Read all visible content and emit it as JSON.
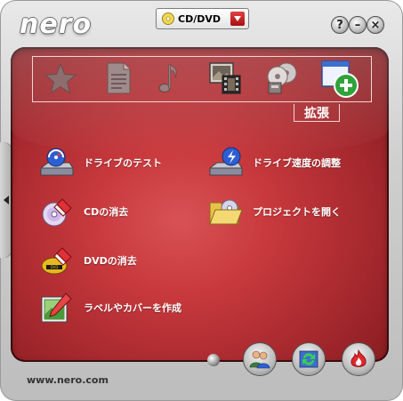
{
  "app": {
    "logo_text": "nero",
    "website": "www.nero.com"
  },
  "mode_selector": {
    "value": "CD/DVD"
  },
  "window_buttons": [
    {
      "name": "help",
      "glyph": "?"
    },
    {
      "name": "minimize",
      "glyph": "–"
    },
    {
      "name": "close",
      "glyph": "×"
    }
  ],
  "categories": {
    "items": [
      {
        "name": "favorites",
        "icon": "star-icon"
      },
      {
        "name": "data",
        "icon": "document-icon"
      },
      {
        "name": "audio",
        "icon": "music-note-icon"
      },
      {
        "name": "photo-video",
        "icon": "film-icon"
      },
      {
        "name": "copy-backup",
        "icon": "disc-copy-icon"
      },
      {
        "name": "extras",
        "icon": "window-add-icon"
      }
    ],
    "selected_label": "拡張"
  },
  "tasks": [
    {
      "label": "ドライブのテスト",
      "icon": "drive-test-icon"
    },
    {
      "label": "ドライブ速度の調整",
      "icon": "drive-speed-icon"
    },
    {
      "label": "CDの消去",
      "icon": "cd-erase-icon"
    },
    {
      "label": "プロジェクトを開く",
      "icon": "open-folder-icon"
    },
    {
      "label": "DVDの消去",
      "icon": "dvd-erase-icon"
    },
    {
      "label": "ラベルやカバーを作成",
      "icon": "label-cover-icon"
    }
  ],
  "bottom_buttons": [
    {
      "name": "users",
      "icon": "users-icon"
    },
    {
      "name": "refresh",
      "icon": "refresh-icon"
    },
    {
      "name": "nero-flame",
      "icon": "nero-flame-icon"
    }
  ],
  "colors": {
    "panel_red": "#c8393d",
    "panel_dark": "#7d191d",
    "frame_gray": "#cfcfcf"
  }
}
